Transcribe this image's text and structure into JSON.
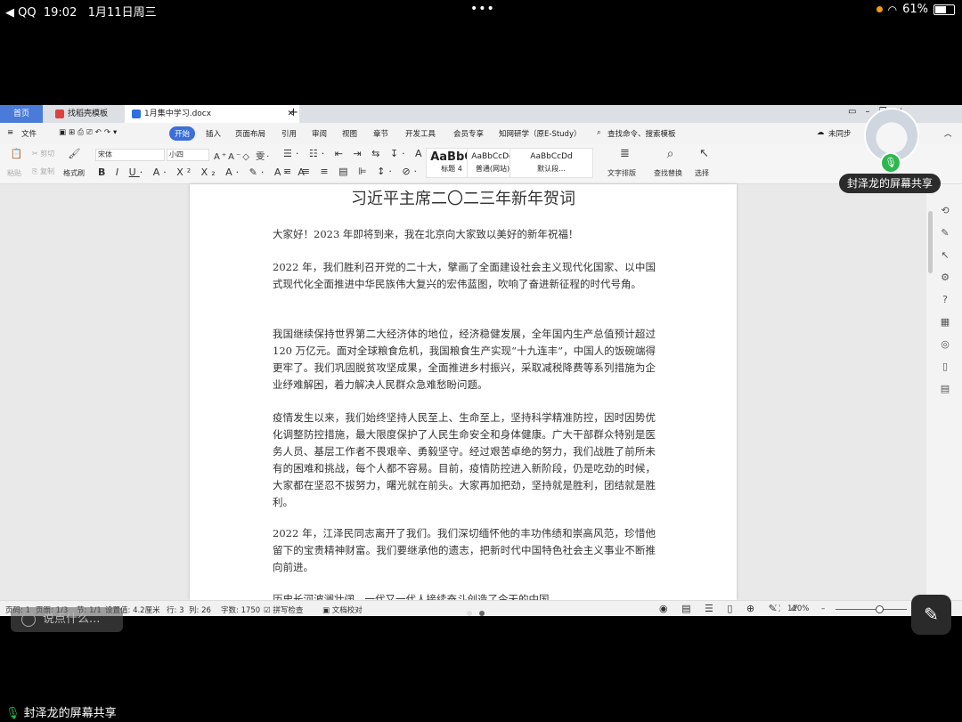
{
  "status_bar": {
    "app": "◀ QQ",
    "time": "19:02",
    "date": "1月11日周三",
    "battery": "61%"
  },
  "tabs": {
    "home": "首页",
    "template": "找稻壳模板",
    "document": "1月集中学习.docx"
  },
  "menu": [
    "文件",
    "开始",
    "插入",
    "页面布局",
    "引用",
    "审阅",
    "视图",
    "章节",
    "开发工具",
    "会员专享",
    "知网研学（原E-Study）"
  ],
  "search_placeholder": "查找命令、搜索模板",
  "collab": "未同步",
  "ribbon": {
    "paste": "粘贴",
    "cut": "剪切",
    "copy": "复制",
    "format_painter": "格式刷",
    "font": "宋体",
    "size": "小四",
    "styles": [
      {
        "sample": "AaBbC",
        "name": "标题 4"
      },
      {
        "sample": "AaBbCcDd",
        "name": "普通(网站)"
      },
      {
        "sample": "AaBbCcDd",
        "name": "默认段..."
      }
    ],
    "text_layout": "文字排版",
    "find_replace": "查找替换",
    "select": "选择"
  },
  "document": {
    "title": "习近平主席二〇二三年新年贺词",
    "paragraphs": [
      "大家好！2023 年即将到来，我在北京向大家致以美好的新年祝福！",
      "2022 年，我们胜利召开党的二十大，擘画了全面建设社会主义现代化国家、以中国式现代化全面推进中华民族伟大复兴的宏伟蓝图，吹响了奋进新征程的时代号角。",
      "我国继续保持世界第二大经济体的地位，经济稳健发展，全年国内生产总值预计超过 120 万亿元。面对全球粮食危机，我国粮食生产实现“十九连丰”，中国人的饭碗端得更牢了。我们巩固脱贫攻坚成果，全面推进乡村振兴，采取减税降费等系列措施为企业纾难解困，着力解决人民群众急难愁盼问题。",
      "疫情发生以来，我们始终坚持人民至上、生命至上，坚持科学精准防控，因时因势优化调整防控措施，最大限度保护了人民生命安全和身体健康。广大干部群众特别是医务人员、基层工作者不畏艰辛、勇毅坚守。经过艰苦卓绝的努力，我们战胜了前所未有的困难和挑战，每个人都不容易。目前，疫情防控进入新阶段，仍是吃劲的时候，大家都在坚忍不拔努力，曙光就在前头。大家再加把劲，坚持就是胜利，团结就是胜利。",
      "2022 年，江泽民同志离开了我们。我们深切缅怀他的丰功伟绩和崇高风范，珍惜他留下的宝贵精神财富。我们要继承他的遗志，把新时代中国特色社会主义事业不断推向前进。",
      "历史长河波澜壮阔，一代又一代人接续奋斗创造了今天的中国。"
    ]
  },
  "status": {
    "page_no": "页码: 1",
    "page": "页面: 1/3",
    "section": "节: 1/1",
    "setting": "设置值: 4.2厘米",
    "row": "行: 3",
    "col": "列: 26",
    "words": "字数: 1750",
    "spell": "拼写检查",
    "proof": "文档校对",
    "zoom": "110%"
  },
  "overlay": {
    "share_name": "封泽龙的屏幕共享",
    "chat_placeholder": "说点什么...",
    "bottom_share": "封泽龙的屏幕共享"
  }
}
